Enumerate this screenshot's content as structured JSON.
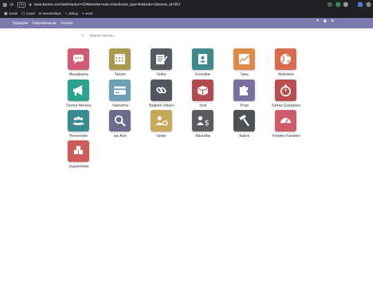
{
  "browser": {
    "url": "www.konien.com/web#action=524&model=sale.order&view_type=list&cids=1&menu_id=352",
    "vpn_label": "VPN",
    "bookmarks": [
      {
        "label": "Gmail",
        "icon": "apps-icon"
      },
      {
        "label": "3.part",
        "icon": "folder-icon"
      },
      {
        "label": "wemoturkiye",
        "icon": "bookmark-icon"
      },
      {
        "label": "debug",
        "icon": "bug-icon"
      },
      {
        "label": "word",
        "icon": "doc-icon"
      }
    ]
  },
  "topnav": {
    "menus": [
      "Siparişler",
      "Faturalanacak",
      "Ürünler"
    ],
    "right_icons": [
      "bell-icon",
      "user-icon",
      "settings-icon"
    ]
  },
  "search": {
    "placeholder": "Search menus..."
  },
  "apps": [
    {
      "label": "Mesajlaşma",
      "color": "#d35a75",
      "icon": "chat-icon"
    },
    {
      "label": "Takvim",
      "color": "#a89a4e",
      "icon": "calendar-icon"
    },
    {
      "label": "Notlar",
      "color": "#555a60",
      "icon": "notes-icon"
    },
    {
      "label": "Kontaklar",
      "color": "#3c8a8c",
      "icon": "contacts-icon"
    },
    {
      "label": "Satış",
      "color": "#e08a48",
      "icon": "sales-icon"
    },
    {
      "label": "Websitesi",
      "color": "#d96a4c",
      "icon": "globe-icon"
    },
    {
      "label": "Destek Merkezi",
      "color": "#2aa38e",
      "icon": "megaphone-icon"
    },
    {
      "label": "Satınalma",
      "color": "#6da0b5",
      "icon": "card-icon"
    },
    {
      "label": "Bağlantı İzleyici",
      "color": "#52575d",
      "icon": "link-icon"
    },
    {
      "label": "Stok",
      "color": "#b04a50",
      "icon": "box-icon"
    },
    {
      "label": "Proje",
      "color": "#7a6fa0",
      "icon": "puzzle-icon"
    },
    {
      "label": "Zaman Çizelgeleri",
      "color": "#b84e4e",
      "icon": "stopwatch-icon"
    },
    {
      "label": "Personeller",
      "color": "#3a8a93",
      "icon": "people-icon"
    },
    {
      "label": "İşe Alım",
      "color": "#6e6c8e",
      "icon": "magnifier-icon"
    },
    {
      "label": "İzinler",
      "color": "#c6a95a",
      "icon": "leave-icon"
    },
    {
      "label": "Masraflar",
      "color": "#5a5c5f",
      "icon": "expense-icon"
    },
    {
      "label": "Bakım",
      "color": "#4d5257",
      "icon": "hammer-icon"
    },
    {
      "label": "Yönetim Panelleri",
      "color": "#cf5a6a",
      "icon": "gauge-icon"
    },
    {
      "label": "Uygulamalar",
      "color": "#cf5a5a",
      "icon": "cubes-icon"
    }
  ]
}
